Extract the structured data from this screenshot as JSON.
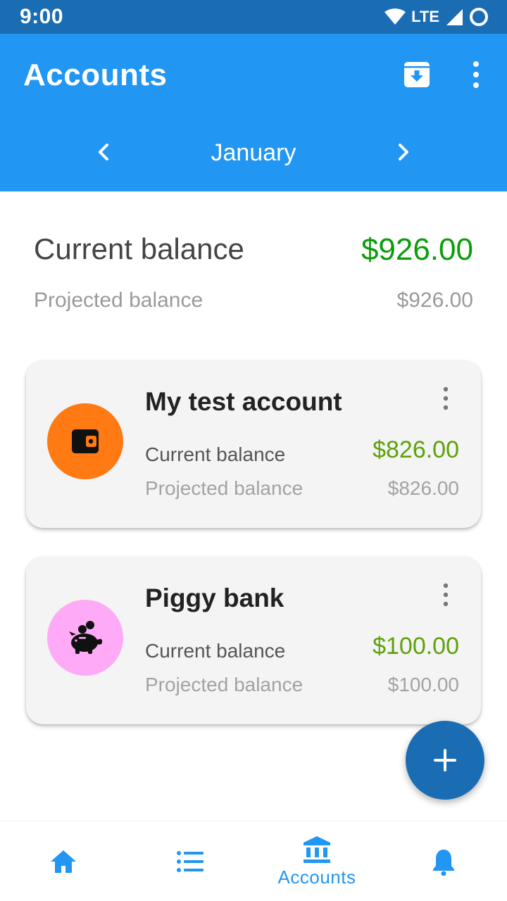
{
  "status_bar": {
    "time": "9:00",
    "network": "LTE"
  },
  "app_bar": {
    "title": "Accounts",
    "month": "January"
  },
  "summary": {
    "current_label": "Current balance",
    "current_value": "$926.00",
    "projected_label": "Projected balance",
    "projected_value": "$926.00"
  },
  "accounts": [
    {
      "name": "My test account",
      "icon": "wallet-icon",
      "color": "#ff7a12",
      "current_label": "Current balance",
      "current_value": "$826.00",
      "projected_label": "Projected balance",
      "projected_value": "$826.00"
    },
    {
      "name": "Piggy bank",
      "icon": "piggy-bank-icon",
      "color": "#ffaaf6",
      "current_label": "Current balance",
      "current_value": "$100.00",
      "projected_label": "Projected balance",
      "projected_value": "$100.00"
    }
  ],
  "bottom_nav": {
    "items": [
      {
        "icon": "home-icon",
        "label": ""
      },
      {
        "icon": "list-icon",
        "label": ""
      },
      {
        "icon": "bank-icon",
        "label": "Accounts"
      },
      {
        "icon": "bell-icon",
        "label": ""
      }
    ],
    "active_index": 2
  },
  "colors": {
    "primary": "#2196f3",
    "primary_dark": "#1a6db3",
    "positive_balance": "#0a9d0a",
    "account_balance": "#5ea10a"
  }
}
